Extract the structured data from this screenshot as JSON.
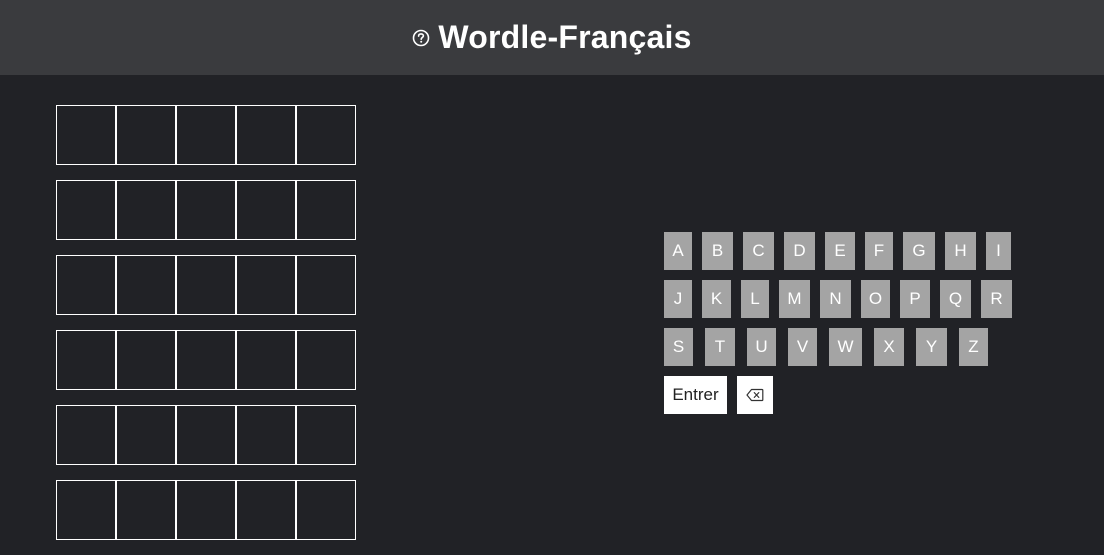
{
  "header": {
    "title": "Wordle-Français",
    "help_icon": "question-circle-icon"
  },
  "grid": {
    "rows": [
      [
        "",
        "",
        "",
        "",
        ""
      ],
      [
        "",
        "",
        "",
        "",
        ""
      ],
      [
        "",
        "",
        "",
        "",
        ""
      ],
      [
        "",
        "",
        "",
        "",
        ""
      ],
      [
        "",
        "",
        "",
        "",
        ""
      ],
      [
        "",
        "",
        "",
        "",
        ""
      ]
    ]
  },
  "keyboard": {
    "row1": [
      "A",
      "B",
      "C",
      "D",
      "E",
      "F",
      "G",
      "H",
      "I"
    ],
    "row2": [
      "J",
      "K",
      "L",
      "M",
      "N",
      "O",
      "P",
      "Q",
      "R"
    ],
    "row3": [
      "S",
      "T",
      "U",
      "V",
      "W",
      "X",
      "Y",
      "Z"
    ],
    "enter_label": "Entrer",
    "backspace_icon": "backspace-icon"
  },
  "colors": {
    "background": "#212226",
    "header": "#3a3b3e",
    "key": "#a4a4a4"
  }
}
